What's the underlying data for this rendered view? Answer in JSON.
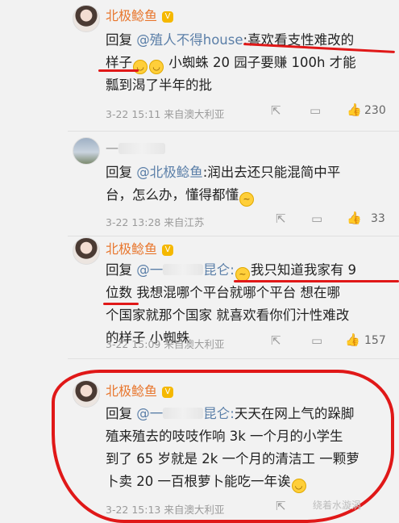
{
  "comments": [
    {
      "name": "北极鲶鱼",
      "mention": "@殖人不得house",
      "text_lines": [
        "回复|@殖人不得house|:喜欢看支性难改的",
        "样子",
        "小蜘蛛 20 园子要赚 100h 才能",
        "瓢到渴了半年的批"
      ],
      "line1_rest": ":喜欢看支性难改的",
      "line2_a": "样子",
      "line2_b": " 小蜘蛛 20 园子要赚 100h 才能",
      "line3": "瓢到渴了半年的批",
      "reply_label": "回复",
      "meta": "3-22 15:11  来自澳大利亚",
      "likes": "230"
    },
    {
      "name": "一",
      "reply_label": "回复",
      "mention": "@北极鲶鱼",
      "line1_rest": ":润出去还只能混简中平",
      "line2": "台，怎么办，懂得都懂",
      "meta": "3-22 13:28  来自江苏",
      "likes": "33"
    },
    {
      "name": "北极鲶鱼",
      "reply_label": "回复",
      "mention": "@一",
      "mention_tail": "昆仑:",
      "line1_rest": "我只知道我家有 9",
      "line2_a": "位数",
      "line2_b": " 我想混哪个平台就哪个平台 想在哪",
      "line3": "个国家就那个国家 就喜欢看你们汁性难改",
      "line4": "的样子 小蜘蛛",
      "meta": "3-22 15:09  来自澳大利亚",
      "likes": "157"
    },
    {
      "name": "北极鲶鱼",
      "reply_label": "回复",
      "mention": "@一",
      "mention_tail": "昆仑:",
      "line1_rest": "天天在网上气的跺脚",
      "line2": "殖来殖去的吱吱作响 3k 一个月的小学生",
      "line3": "到了 65 岁就是 2k 一个月的清洁工 一颗萝",
      "line4": "卜卖 20 一百根萝卜能吃一年诶",
      "meta": "3-22 15:13  来自澳大利亚"
    }
  ],
  "icons": {
    "share": "share-icon",
    "comment": "comment-icon",
    "like": "thumbs-up-icon",
    "vip": "vip-badge-icon",
    "emoji": "grin-emoji-icon"
  },
  "watermark": "绕着水漩涡",
  "colors": {
    "name": "#e8762d",
    "mention": "#5b7fa8",
    "annotation": "#e01818"
  }
}
